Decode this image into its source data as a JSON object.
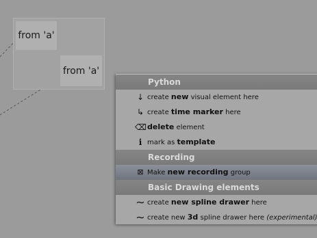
{
  "nodes": {
    "node_a_top": "from 'a'",
    "node_a_bottom": "from 'a'"
  },
  "menu": {
    "sections": [
      {
        "header": "Python",
        "items": [
          {
            "icon": "down-arrow-icon",
            "glyph": "↓",
            "pre": "create ",
            "bold": "new",
            "post": " visual element here",
            "italic": ""
          },
          {
            "icon": "time-marker-icon",
            "glyph": "↳",
            "pre": "create ",
            "bold": "time marker",
            "post": " here",
            "italic": ""
          },
          {
            "icon": "delete-icon",
            "glyph": "⌫",
            "pre": "",
            "bold": "delete",
            "post": " element",
            "italic": ""
          },
          {
            "icon": "info-icon",
            "glyph": "i",
            "pre": "mark as ",
            "bold": "template",
            "post": "",
            "italic": ""
          }
        ]
      },
      {
        "header": "Recording",
        "items": [
          {
            "icon": "record-icon",
            "glyph": "⊠",
            "pre": "Make ",
            "bold": "new recording",
            "post": " group",
            "italic": ""
          }
        ]
      },
      {
        "header": "Basic Drawing elements",
        "items": [
          {
            "icon": "spline-icon",
            "glyph": "∼",
            "pre": "create ",
            "bold": "new spline drawer",
            "post": " here",
            "italic": ""
          },
          {
            "icon": "spline-icon",
            "glyph": "∼",
            "pre": "create new ",
            "bold": "3d",
            "post": " spline drawer here ",
            "italic": "(experimental)"
          }
        ]
      }
    ]
  },
  "colors": {
    "canvas": "#9b9b9b",
    "menu_bg": "#a7a7a7",
    "header_bg": "#7f7f7f",
    "header_text": "#d9d9d9",
    "selected_bg": "#7d828c"
  }
}
